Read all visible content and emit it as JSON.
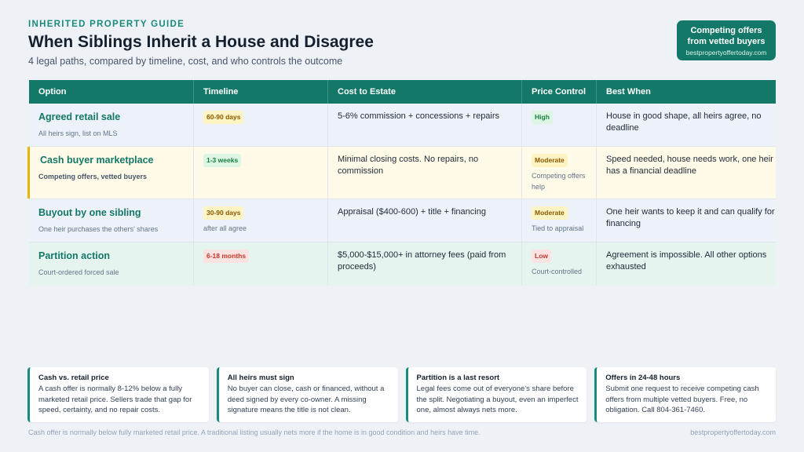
{
  "header": {
    "eyebrow": "INHERITED PROPERTY GUIDE",
    "title": "When Siblings Inherit a House and Disagree",
    "subtitle": "4 legal paths, compared by timeline, cost, and who controls the outcome"
  },
  "cta": {
    "line1": "Competing offers",
    "line2": "from vetted buyers",
    "url": "bestpropertyoffertoday.com"
  },
  "table": {
    "headers": [
      "Option",
      "Timeline",
      "Cost to Estate",
      "Price Control",
      "Best When"
    ],
    "rows": [
      {
        "option": "Agreed retail sale",
        "sub": "All heirs sign, list on MLS",
        "timeline": "60-90 days",
        "timeline_note": "",
        "cost": "5-6% commission + concessions + repairs",
        "control": "High",
        "control_note": "",
        "best": "House in good shape, all heirs agree, no deadline"
      },
      {
        "option": "Cash buyer marketplace",
        "sub": "Competing offers, vetted buyers",
        "timeline": "1-3 weeks",
        "timeline_note": "",
        "cost": "Minimal closing costs. No repairs, no commission",
        "control": "Moderate",
        "control_note": "Competing offers help",
        "best": "Speed needed, house needs work, one heir has a financial deadline"
      },
      {
        "option": "Buyout by one sibling",
        "sub": "One heir purchases the others' shares",
        "timeline": "30-90 days",
        "timeline_note": "after all agree",
        "cost": "Appraisal ($400-600) + title + financing",
        "control": "Moderate",
        "control_note": "Tied to appraisal",
        "best": "One heir wants to keep it and can qualify for financing"
      },
      {
        "option": "Partition action",
        "sub": "Court-ordered forced sale",
        "timeline": "6-18 months",
        "timeline_note": "",
        "cost": "$5,000-$15,000+ in attorney fees (paid from proceeds)",
        "control": "Low",
        "control_note": "Court-controlled",
        "best": "Agreement is impossible. All other options exhausted"
      }
    ]
  },
  "cards": [
    {
      "title": "Cash vs. retail price",
      "body": "A cash offer is normally 8-12% below a fully marketed retail price. Sellers trade that gap for speed, certainty, and no repair costs."
    },
    {
      "title": "All heirs must sign",
      "body": "No buyer can close, cash or financed, without a deed signed by every co-owner. A missing signature means the title is not clean."
    },
    {
      "title": "Partition is a last resort",
      "body": "Legal fees come out of everyone's share before the split. Negotiating a buyout, even an imperfect one, almost always nets more."
    },
    {
      "title": "Offers in 24-48 hours",
      "body": "Submit one request to receive competing cash offers from multiple vetted buyers. Free, no obligation. Call 804-361-7460."
    }
  ],
  "footer": {
    "note": "Cash offer is normally below fully marketed retail price. A traditional listing usually nets more if the home is in good condition and heirs have time.",
    "url": "bestpropertyoffertoday.com"
  },
  "colors": {
    "brand": "#137867",
    "accent_yellow": "#eab308",
    "badge_green": "#16803c",
    "badge_yellow": "#8a5a00",
    "badge_red": "#c0392b"
  }
}
